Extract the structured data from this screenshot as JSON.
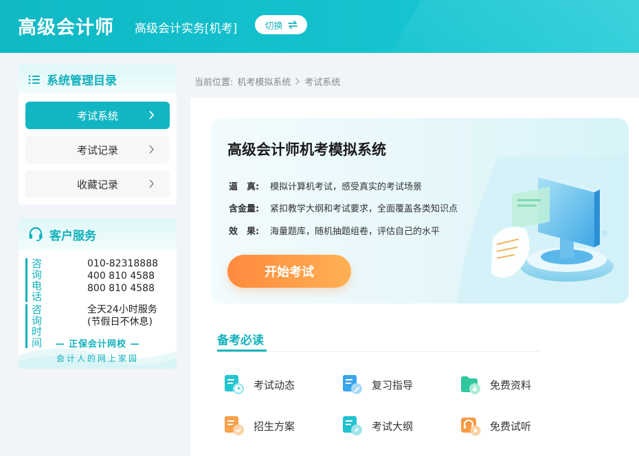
{
  "header": {
    "logo_title": "高级会计师",
    "exam_name": "高级会计实务[机考]",
    "switch_label": "切换"
  },
  "sidebar": {
    "catalog_title": "系统管理目录",
    "items": [
      {
        "label": "考试系统",
        "active": true
      },
      {
        "label": "考试记录",
        "active": false
      },
      {
        "label": "收藏记录",
        "active": false
      }
    ],
    "service": {
      "title": "客户服务",
      "phone_label": "咨询电话",
      "phones": [
        "010-82318888",
        "400 810 4588",
        "800 810 4588"
      ],
      "time_label": "咨询时间",
      "time_value": "全天24小时服务",
      "time_note": "(节假日不休息)",
      "brand_line1": "— 正保会计网校 —",
      "brand_line2": "会计人的网上家园"
    }
  },
  "breadcrumb": {
    "prefix": "当前位置:",
    "items": [
      "机考模拟系统",
      "考试系统"
    ]
  },
  "hero": {
    "title": "高级会计师机考模拟系统",
    "features": [
      {
        "key": "逼　真:",
        "value": "模拟计算机考试，感受真实的考试场景"
      },
      {
        "key": "含金量:",
        "value": "紧扣教学大纲和考试要求，全面覆盖各类知识点"
      },
      {
        "key": "效　果:",
        "value": "海量题库，随机抽题组卷，评估自己的水平"
      }
    ],
    "start_label": "开始考试"
  },
  "prep": {
    "title": "备考必读",
    "links": [
      {
        "label": "考试动态",
        "icon": "news-clock-icon"
      },
      {
        "label": "复习指导",
        "icon": "guide-pen-icon"
      },
      {
        "label": "免费资料",
        "icon": "folder-download-icon"
      },
      {
        "label": "招生方案",
        "icon": "document-check-icon"
      },
      {
        "label": "考试大纲",
        "icon": "outline-compass-icon"
      },
      {
        "label": "免费试听",
        "icon": "headphones-play-icon"
      }
    ]
  },
  "colors": {
    "primary": "#12b6c3",
    "accent": "#ff8a3d"
  }
}
